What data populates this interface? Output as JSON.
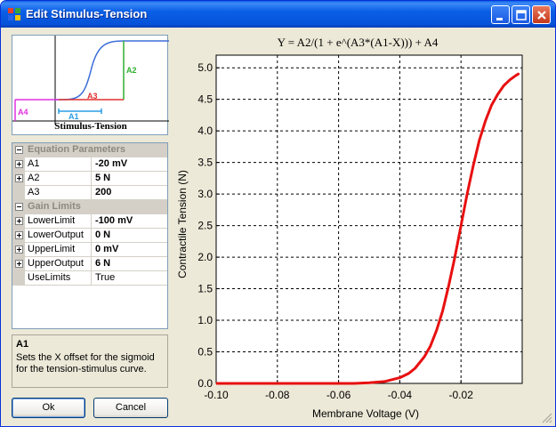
{
  "window": {
    "title": "Edit Stimulus-Tension"
  },
  "preview": {
    "caption": "Stimulus-Tension",
    "labels": {
      "a1": "A1",
      "a2": "A2",
      "a3": "A3",
      "a4": "A4"
    },
    "colors": {
      "curve": "#3d6fd8",
      "a1": "#2a9de8",
      "a2": "#30b030",
      "a3": "#e03030",
      "a4": "#e030e0"
    }
  },
  "property_grid": {
    "categories": [
      {
        "label": "Equation Parameters",
        "rows": [
          {
            "name": "A1",
            "value": "-20 mV"
          },
          {
            "name": "A2",
            "value": "5 N"
          },
          {
            "name": "A3",
            "value": "200"
          }
        ]
      },
      {
        "label": "Gain Limits",
        "rows": [
          {
            "name": "LowerLimit",
            "value": "-100 mV"
          },
          {
            "name": "LowerOutput",
            "value": "0 N"
          },
          {
            "name": "UpperLimit",
            "value": "0 mV"
          },
          {
            "name": "UpperOutput",
            "value": "6 N"
          },
          {
            "name": "UseLimits",
            "value": "True"
          }
        ]
      }
    ]
  },
  "help": {
    "title": "A1",
    "description": "Sets the X offset for the sigmoid for the tension-stimulus curve."
  },
  "buttons": {
    "ok": "Ok",
    "cancel": "Cancel"
  },
  "chart_data": {
    "type": "line",
    "title": "Y = A2/(1 + e^(A3*(A1-X))) + A4",
    "xlabel": "Membrane Voltage (V)",
    "ylabel": "Contractile Tension (N)",
    "xlim": [
      -0.1,
      0.0
    ],
    "ylim": [
      0,
      5.2
    ],
    "x_ticks": [
      -0.1,
      -0.08,
      -0.06,
      -0.04,
      -0.02
    ],
    "x_tick_labels": [
      "-0.10",
      "-0.08",
      "-0.06",
      "-0.04",
      "-0.02"
    ],
    "y_ticks": [
      0,
      0.5,
      1.0,
      1.5,
      2.0,
      2.5,
      3.0,
      3.5,
      4.0,
      4.5,
      5.0
    ],
    "y_tick_labels": [
      "0.0",
      "0.5",
      "1.0",
      "1.5",
      "2.0",
      "2.5",
      "3.0",
      "3.5",
      "4.0",
      "4.5",
      "5.0"
    ],
    "grid": true,
    "series": [
      {
        "color": "#e81010",
        "x": [
          -0.1,
          -0.09,
          -0.08,
          -0.07,
          -0.06,
          -0.055,
          -0.05,
          -0.045,
          -0.04,
          -0.037,
          -0.035,
          -0.032,
          -0.03,
          -0.028,
          -0.026,
          -0.024,
          -0.022,
          -0.02,
          -0.018,
          -0.016,
          -0.014,
          -0.012,
          -0.01,
          -0.008,
          -0.006,
          -0.004,
          -0.002,
          -0.001
        ],
        "y": [
          0.0,
          0.0,
          0.0,
          0.0,
          0.0,
          0.0,
          0.01,
          0.03,
          0.09,
          0.16,
          0.24,
          0.42,
          0.59,
          0.84,
          1.15,
          1.55,
          2.0,
          2.5,
          3.0,
          3.45,
          3.85,
          4.16,
          4.41,
          4.58,
          4.72,
          4.81,
          4.88,
          4.91
        ]
      }
    ]
  }
}
